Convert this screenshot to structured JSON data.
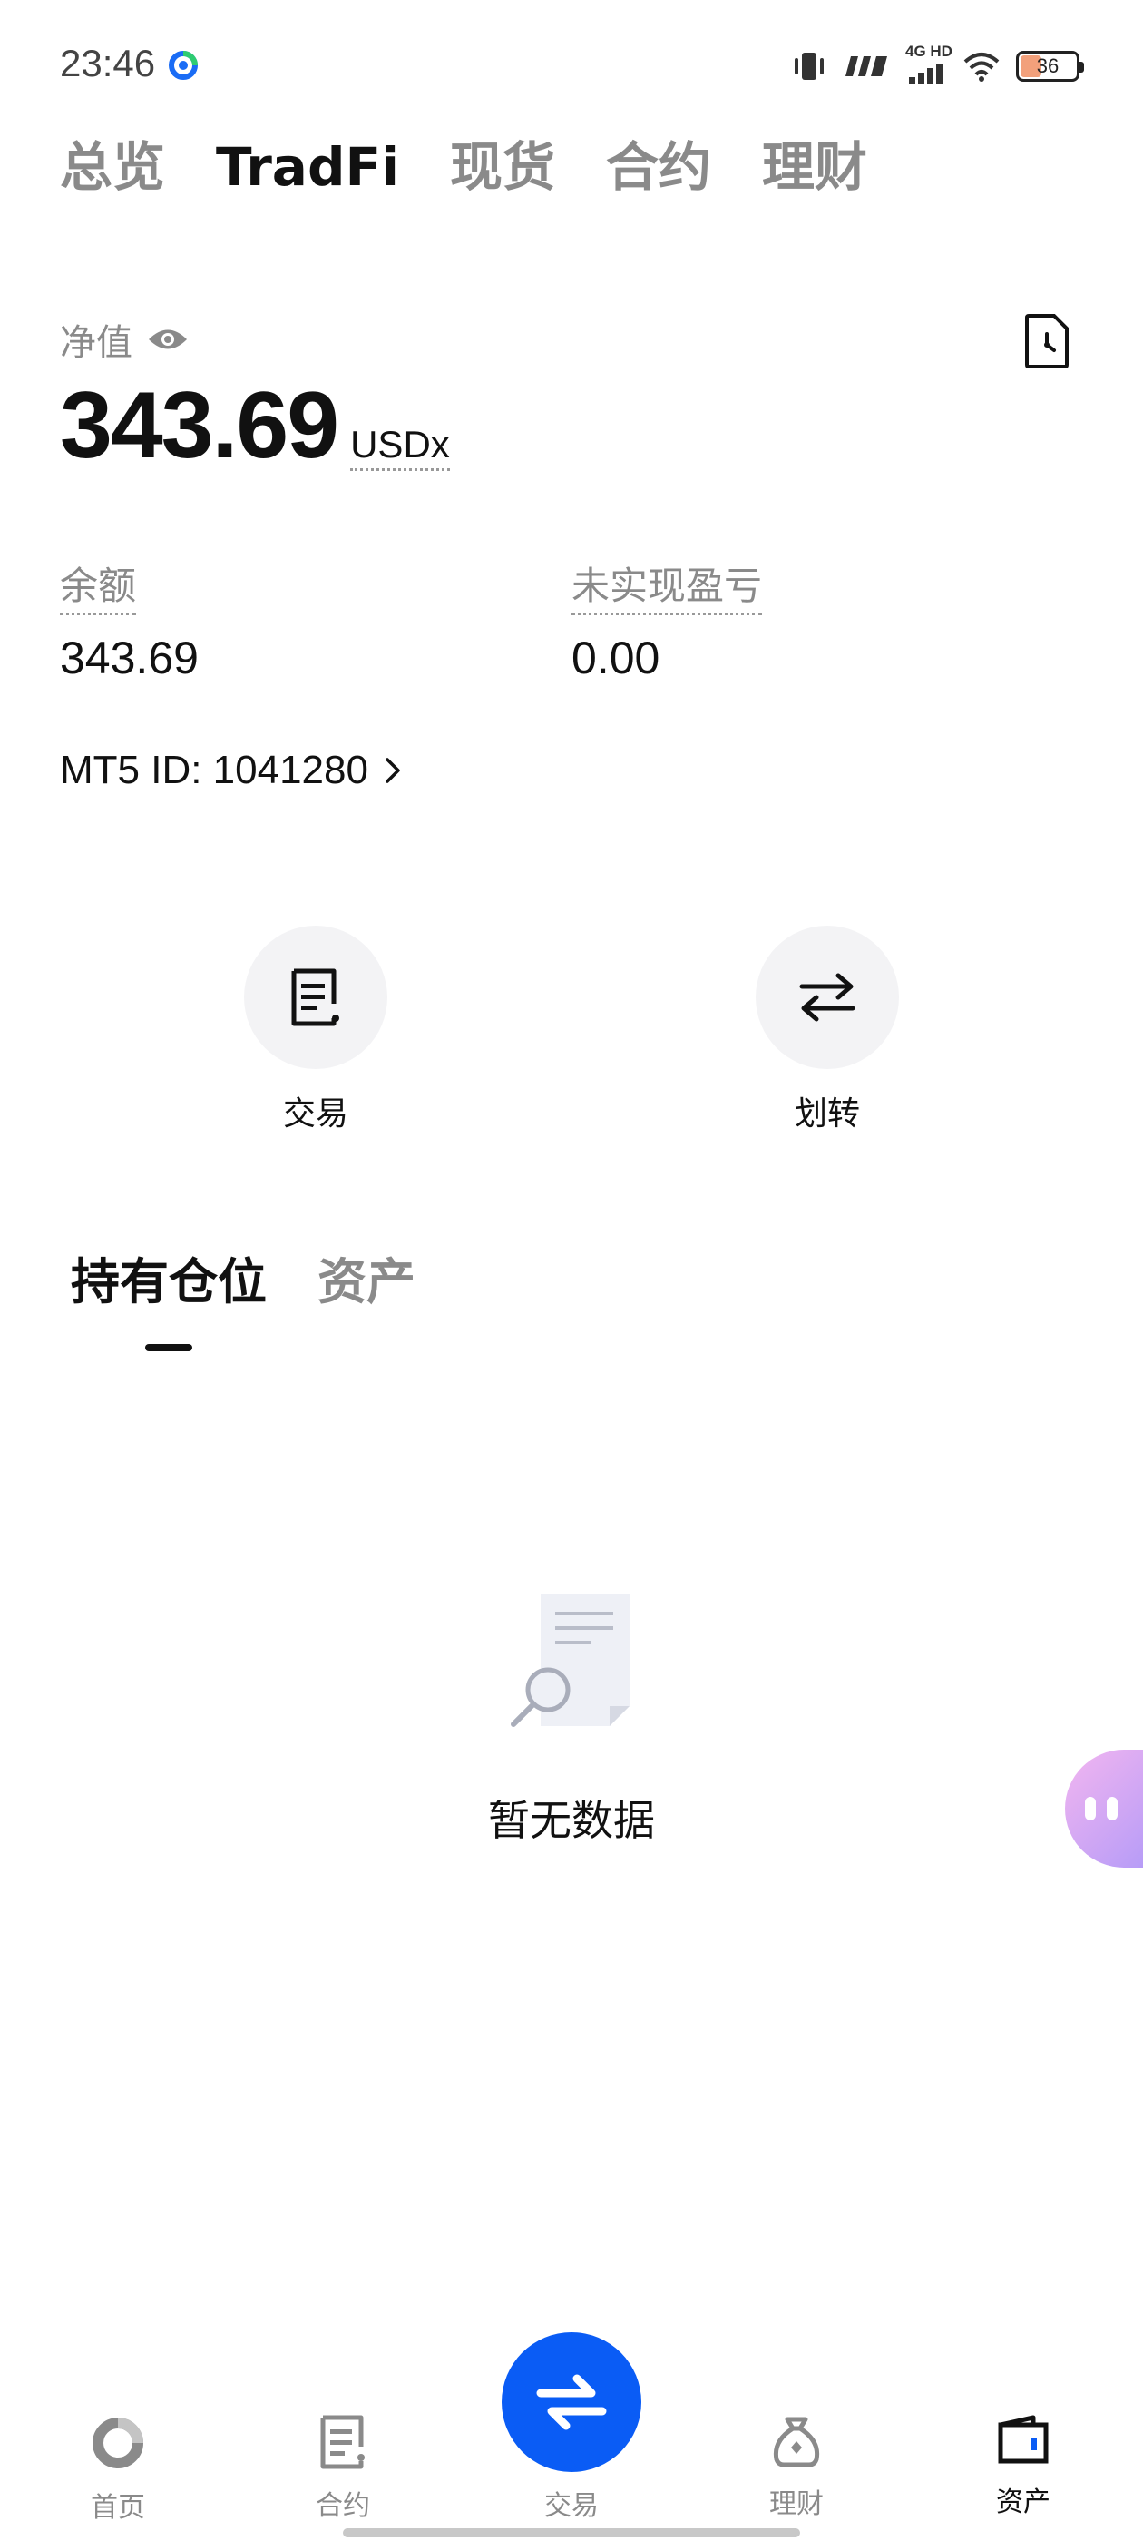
{
  "status_bar": {
    "time": "23:46",
    "network_label": "4G HD",
    "battery": "36",
    "icons": [
      "vibrate-icon",
      "signal-icon",
      "wifi-icon",
      "battery-icon"
    ]
  },
  "top_tabs": [
    {
      "label": "总览",
      "active": false
    },
    {
      "label": "TradFi",
      "active": true
    },
    {
      "label": "现货",
      "active": false
    },
    {
      "label": "合约",
      "active": false
    },
    {
      "label": "理财",
      "active": false
    }
  ],
  "net_value": {
    "label": "净值",
    "value": "343.69",
    "unit": "USDx"
  },
  "balance": {
    "label": "余额",
    "value": "343.69"
  },
  "unrealized_pnl": {
    "label": "未实现盈亏",
    "value": "0.00"
  },
  "mt5": {
    "text": "MT5 ID: 1041280"
  },
  "actions": {
    "trade_label": "交易",
    "transfer_label": "划转"
  },
  "section_tabs": [
    {
      "label": "持有仓位",
      "active": true
    },
    {
      "label": "资产",
      "active": false
    }
  ],
  "empty_state": {
    "text": "暂无数据"
  },
  "bottom_nav": {
    "home": "首页",
    "futures": "合约",
    "trade": "交易",
    "earn": "理财",
    "assets": "资产",
    "active": "assets"
  },
  "colors": {
    "accent": "#0a5cf5",
    "text_primary": "#111111",
    "text_secondary": "#8a8a8a"
  }
}
